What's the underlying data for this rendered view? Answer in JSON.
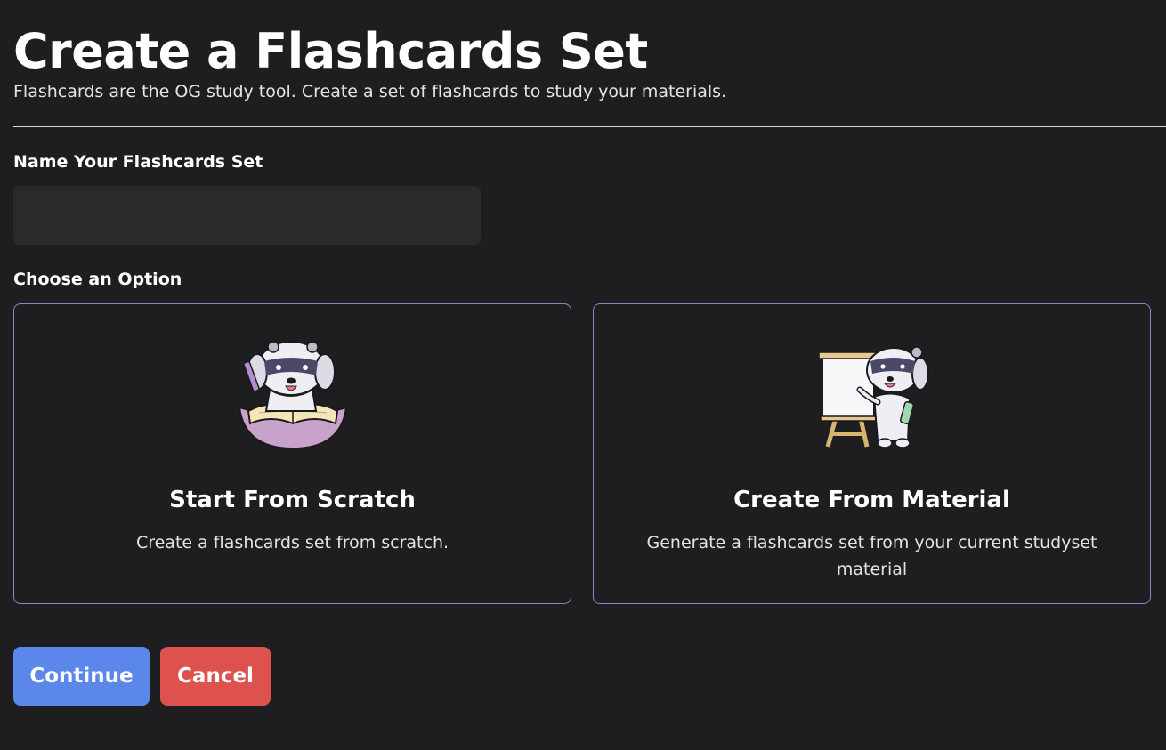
{
  "header": {
    "title": "Create a Flashcards Set",
    "subtitle": "Flashcards are the OG study tool. Create a set of flashcards to study your materials."
  },
  "name_field": {
    "label": "Name Your Flashcards Set",
    "value": "",
    "placeholder": ""
  },
  "options": {
    "label": "Choose an Option",
    "items": [
      {
        "title": "Start From Scratch",
        "description": "Create a flashcards set from scratch.",
        "icon": "mascot-writing-book-icon"
      },
      {
        "title": "Create From Material",
        "description": "Generate a flashcards set from your current studyset material",
        "icon": "mascot-presenting-whiteboard-icon"
      }
    ]
  },
  "actions": {
    "continue_label": "Continue",
    "cancel_label": "Cancel"
  },
  "colors": {
    "background": "#1e1e20",
    "input_background": "#2a2a2d",
    "card_border": "#8d83c9",
    "continue_button": "#5b86ea",
    "cancel_button": "#dd524e"
  }
}
